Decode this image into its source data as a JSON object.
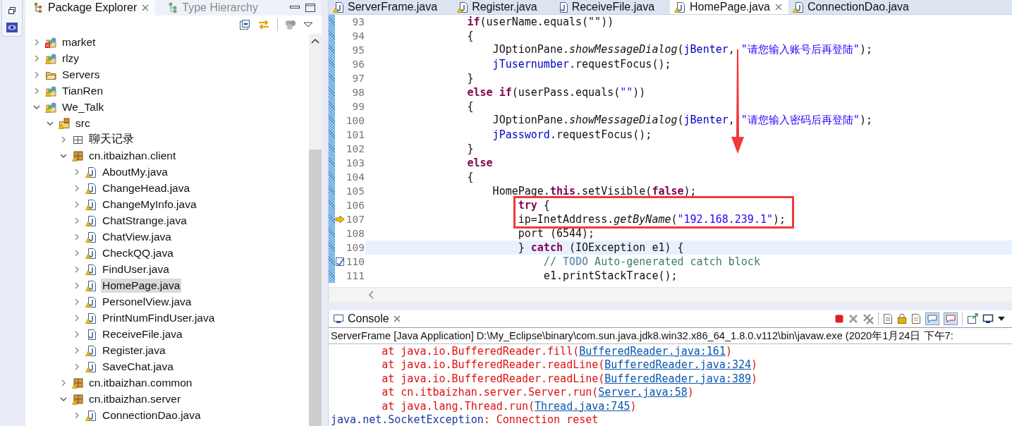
{
  "explorer": {
    "tabs": [
      {
        "label": "Package Explorer",
        "selected": true
      },
      {
        "label": "Type Hierarchy",
        "selected": false
      }
    ],
    "tree": [
      {
        "label": "market",
        "kind": "project",
        "error": true,
        "warning": false,
        "expanded": false,
        "selected": false
      },
      {
        "label": "rlzy",
        "kind": "project",
        "error": false,
        "warning": true,
        "expanded": false,
        "selected": false
      },
      {
        "label": "Servers",
        "kind": "folder",
        "error": false,
        "warning": false,
        "expanded": false,
        "selected": false
      },
      {
        "label": "TianRen",
        "kind": "project",
        "error": false,
        "warning": true,
        "expanded": false,
        "selected": false
      },
      {
        "label": "We_Talk",
        "kind": "project",
        "error": false,
        "warning": true,
        "expanded": true,
        "selected": false,
        "children": [
          {
            "label": "src",
            "kind": "source",
            "error": false,
            "warning": true,
            "expanded": true,
            "selected": false,
            "children": [
              {
                "label": "聊天记录",
                "kind": "empty-package",
                "error": false,
                "warning": false,
                "expanded": false,
                "selected": false
              },
              {
                "label": "cn.itbaizhan.client",
                "kind": "package",
                "error": false,
                "warning": true,
                "expanded": true,
                "selected": false,
                "children": [
                  {
                    "label": "AboutMy.java",
                    "kind": "file",
                    "error": false,
                    "warning": true,
                    "expanded": false,
                    "selected": false
                  },
                  {
                    "label": "ChangeHead.java",
                    "kind": "file",
                    "error": false,
                    "warning": true,
                    "expanded": false,
                    "selected": false
                  },
                  {
                    "label": "ChangeMyInfo.java",
                    "kind": "file",
                    "error": false,
                    "warning": true,
                    "expanded": false,
                    "selected": false
                  },
                  {
                    "label": "ChatStrange.java",
                    "kind": "file",
                    "error": false,
                    "warning": true,
                    "expanded": false,
                    "selected": false
                  },
                  {
                    "label": "ChatView.java",
                    "kind": "file",
                    "error": false,
                    "warning": true,
                    "expanded": false,
                    "selected": false
                  },
                  {
                    "label": "CheckQQ.java",
                    "kind": "file",
                    "error": false,
                    "warning": true,
                    "expanded": false,
                    "selected": false
                  },
                  {
                    "label": "FindUser.java",
                    "kind": "file",
                    "error": false,
                    "warning": true,
                    "expanded": false,
                    "selected": false
                  },
                  {
                    "label": "HomePage.java",
                    "kind": "file",
                    "error": false,
                    "warning": true,
                    "expanded": false,
                    "selected": true
                  },
                  {
                    "label": "PersonelView.java",
                    "kind": "file",
                    "error": false,
                    "warning": true,
                    "expanded": false,
                    "selected": false
                  },
                  {
                    "label": "PrintNumFindUser.java",
                    "kind": "file",
                    "error": false,
                    "warning": true,
                    "expanded": false,
                    "selected": false
                  },
                  {
                    "label": "ReceiveFile.java",
                    "kind": "file",
                    "error": false,
                    "warning": false,
                    "expanded": false,
                    "selected": false
                  },
                  {
                    "label": "Register.java",
                    "kind": "file",
                    "error": false,
                    "warning": true,
                    "expanded": false,
                    "selected": false
                  },
                  {
                    "label": "SaveChat.java",
                    "kind": "file",
                    "error": false,
                    "warning": true,
                    "expanded": false,
                    "selected": false
                  }
                ]
              },
              {
                "label": "cn.itbaizhan.common",
                "kind": "package",
                "error": false,
                "warning": true,
                "expanded": false,
                "selected": false
              },
              {
                "label": "cn.itbaizhan.server",
                "kind": "package",
                "error": false,
                "warning": true,
                "expanded": true,
                "selected": false,
                "children": [
                  {
                    "label": "ConnectionDao.java",
                    "kind": "file",
                    "error": false,
                    "warning": true,
                    "expanded": false,
                    "selected": false
                  }
                ]
              }
            ]
          }
        ]
      }
    ]
  },
  "editor": {
    "tabs": [
      {
        "label": "ServerFrame.java",
        "warning": true,
        "selected": false
      },
      {
        "label": "Register.java",
        "warning": true,
        "selected": false
      },
      {
        "label": "ReceiveFile.java",
        "warning": false,
        "selected": false
      },
      {
        "label": "HomePage.java",
        "warning": true,
        "selected": true
      },
      {
        "label": "ConnectionDao.java",
        "warning": true,
        "selected": false
      }
    ],
    "lines": [
      {
        "number": "93",
        "current": false,
        "tokens": [
          {
            "kind": "keyword",
            "text": "                if"
          },
          {
            "kind": "plain",
            "text": "(userName.equals(\"\"))"
          }
        ]
      },
      {
        "number": "94",
        "current": false,
        "tokens": [
          {
            "kind": "plain",
            "text": "                {"
          }
        ]
      },
      {
        "number": "95",
        "current": false,
        "tokens": [
          {
            "kind": "plain",
            "text": "                    JOptionPane."
          },
          {
            "kind": "static",
            "text": "showMessageDialog"
          },
          {
            "kind": "plain",
            "text": "("
          },
          {
            "kind": "field",
            "text": "jBenter"
          },
          {
            "kind": "plain",
            "text": ", "
          },
          {
            "kind": "string",
            "text": "\"请您输入账号后再登陆\""
          },
          {
            "kind": "plain",
            "text": ");"
          }
        ]
      },
      {
        "number": "96",
        "current": false,
        "tokens": [
          {
            "kind": "field",
            "text": "                    jTusernumber"
          },
          {
            "kind": "plain",
            "text": ".requestFocus();"
          }
        ]
      },
      {
        "number": "97",
        "current": false,
        "tokens": [
          {
            "kind": "plain",
            "text": "                }"
          }
        ]
      },
      {
        "number": "98",
        "current": false,
        "tokens": [
          {
            "kind": "keyword",
            "text": "                else if"
          },
          {
            "kind": "plain",
            "text": "(userPass.equals("
          },
          {
            "kind": "string",
            "text": "\"\""
          },
          {
            "kind": "plain",
            "text": "))"
          }
        ]
      },
      {
        "number": "99",
        "current": false,
        "tokens": [
          {
            "kind": "plain",
            "text": "                {"
          }
        ]
      },
      {
        "number": "100",
        "current": false,
        "tokens": [
          {
            "kind": "plain",
            "text": "                    JOptionPane."
          },
          {
            "kind": "static",
            "text": "showMessageDialog"
          },
          {
            "kind": "plain",
            "text": "("
          },
          {
            "kind": "field",
            "text": "jBenter"
          },
          {
            "kind": "plain",
            "text": ", "
          },
          {
            "kind": "string",
            "text": "\"请您输入密码后再登陆\""
          },
          {
            "kind": "plain",
            "text": ");"
          }
        ]
      },
      {
        "number": "101",
        "current": false,
        "tokens": [
          {
            "kind": "field",
            "text": "                    jPassword"
          },
          {
            "kind": "plain",
            "text": ".requestFocus();"
          }
        ]
      },
      {
        "number": "102",
        "current": false,
        "tokens": [
          {
            "kind": "plain",
            "text": "                }"
          }
        ]
      },
      {
        "number": "103",
        "current": false,
        "tokens": [
          {
            "kind": "keyword",
            "text": "                else"
          }
        ]
      },
      {
        "number": "104",
        "current": false,
        "tokens": [
          {
            "kind": "plain",
            "text": "                {"
          }
        ]
      },
      {
        "number": "105",
        "current": false,
        "tokens": [
          {
            "kind": "plain",
            "text": "                    HomePage."
          },
          {
            "kind": "keyword",
            "text": "this"
          },
          {
            "kind": "plain",
            "text": ".setVisible("
          },
          {
            "kind": "keyword",
            "text": "false"
          },
          {
            "kind": "plain",
            "text": ");"
          }
        ]
      },
      {
        "number": "106",
        "current": false,
        "tokens": [
          {
            "kind": "keyword",
            "text": "                        try"
          },
          {
            "kind": "plain",
            "text": " {"
          }
        ]
      },
      {
        "number": "107",
        "current": false,
        "kind": "arrow",
        "tokens": [
          {
            "kind": "plain",
            "text": "                        ip=InetAddress."
          },
          {
            "kind": "static",
            "text": "getByName"
          },
          {
            "kind": "plain",
            "text": "("
          },
          {
            "kind": "string",
            "text": "\"192.168.239.1\""
          },
          {
            "kind": "plain",
            "text": ");"
          }
        ]
      },
      {
        "number": "108",
        "current": false,
        "tokens": [
          {
            "kind": "plain",
            "text": "                        port (6544);"
          }
        ]
      },
      {
        "number": "109",
        "current": true,
        "tokens": [
          {
            "kind": "plain",
            "text": "                        } "
          },
          {
            "kind": "keyword",
            "text": "catch"
          },
          {
            "kind": "plain",
            "text": " (IOException e1) {"
          }
        ]
      },
      {
        "number": "110",
        "current": false,
        "kind": "task",
        "tokens": [
          {
            "kind": "comment",
            "text": "                            // "
          },
          {
            "kind": "todo",
            "text": "TODO"
          },
          {
            "kind": "comment",
            "text": " Auto-generated catch block"
          }
        ]
      },
      {
        "number": "111",
        "current": false,
        "tokens": [
          {
            "kind": "plain",
            "text": "                            e1.printStackTrace();"
          }
        ]
      }
    ]
  },
  "console": {
    "title": "Console",
    "description": "ServerFrame [Java Application] D:\\My_Eclipse\\binary\\com.sun.java.jdk8.win32.x86_64_1.8.0.v112\\bin\\javaw.exe (2020年1月24日 下午7:",
    "lines": [
      [
        {
          "kind": "error",
          "text": "\tat java.io.BufferedReader.fill("
        },
        {
          "kind": "link",
          "text": "BufferedReader.java:161"
        },
        {
          "kind": "error",
          "text": ")"
        }
      ],
      [
        {
          "kind": "error",
          "text": "\tat java.io.BufferedReader.readLine("
        },
        {
          "kind": "link",
          "text": "BufferedReader.java:324"
        },
        {
          "kind": "error",
          "text": ")"
        }
      ],
      [
        {
          "kind": "error",
          "text": "\tat java.io.BufferedReader.readLine("
        },
        {
          "kind": "link",
          "text": "BufferedReader.java:389"
        },
        {
          "kind": "error",
          "text": ")"
        }
      ],
      [
        {
          "kind": "error",
          "text": "\tat cn.itbaizhan.server.Server.run("
        },
        {
          "kind": "link",
          "text": "Server.java:58"
        },
        {
          "kind": "error",
          "text": ")"
        }
      ],
      [
        {
          "kind": "error",
          "text": "\tat java.lang.Thread.run("
        },
        {
          "kind": "link",
          "text": "Thread.java:745"
        },
        {
          "kind": "error",
          "text": ")"
        }
      ],
      [
        {
          "kind": "exception",
          "text": "java.net.SocketException"
        },
        {
          "kind": "error",
          "text": ": Connection reset"
        }
      ]
    ]
  }
}
